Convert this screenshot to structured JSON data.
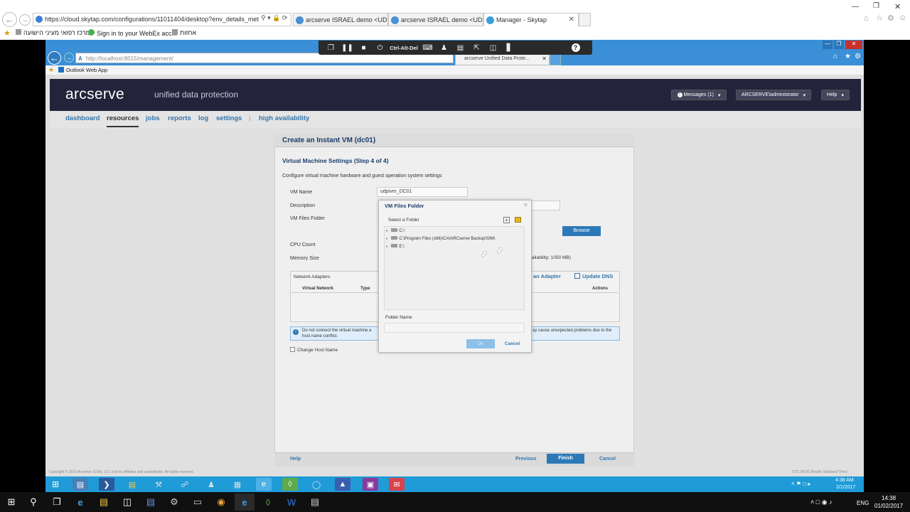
{
  "outer_browser": {
    "address": "https://cloud.skytap.com/configurations/11011404/desktop?env_details_meta_info=",
    "tabs": [
      {
        "label": "arcserve ISRAEL demo <UDP v..."
      },
      {
        "label": "arcserve ISRAEL demo <UDP v..."
      },
      {
        "label": "Manager - Skytap"
      }
    ],
    "favorites": [
      "מרכז רפואי מעיני הישועה",
      "Sign in to your WebEx acc...",
      "אחזות"
    ]
  },
  "remote_toolbar": {
    "ctrl_alt_del": "Ctrl-Alt-Del",
    "help_glyph": "?"
  },
  "inner_browser": {
    "address": "http://localhost:8015/management/",
    "tab_label": "arcserve Unified Data Prote...",
    "favorite": "Outlook Web App"
  },
  "arcserve": {
    "logo": "arcserve",
    "tagline": "unified data protection",
    "header_buttons": {
      "messages": "Messages (1)",
      "user": "ARCSERVE\\administrator",
      "help": "Help"
    },
    "nav": [
      "dashboard",
      "resources",
      "jobs",
      "reports",
      "log",
      "settings",
      "high availability"
    ]
  },
  "wizard": {
    "title": "Create an Instant VM (dc01)",
    "step_title": "Virtual Machine Settings (Step 4 of 4)",
    "description": "Configure virtual machine hardware and guest operation system settings",
    "labels": {
      "vm_name": "VM Name",
      "description": "Description",
      "vm_files_folder": "VM Files Folder",
      "cpu_count": "CPU Count",
      "memory_size": "Memory Size"
    },
    "vm_name_value": "udpivm_DC01",
    "browse_label": "Browse",
    "availability_text": "ailability: 1050 MB)",
    "network_adapters": {
      "title": "Network Adapters",
      "add_adapter": "an Adapter",
      "update_dns": "Update DNS",
      "columns": {
        "virtual_network": "Virtual Network",
        "type": "Type",
        "actions": "Actions"
      }
    },
    "info_text_1": "Do not connect the virtual machine a",
    "info_text_1b": "ay cause unexpected problems due to the",
    "info_text_2": "host name conflict.",
    "change_host_name": "Change Host Name",
    "footer": {
      "help": "Help",
      "previous": "Previous",
      "finish": "Finish",
      "cancel": "Cancel"
    }
  },
  "dialog": {
    "title": "VM Files Folder",
    "select_label": "Select a Folder",
    "folders": [
      "C:\\",
      "C:\\Program Files (x86)\\CA\\ARCserve Backup\\SIM\\",
      "E:\\"
    ],
    "folder_name_label": "Folder Name",
    "ok": "OK",
    "cancel": "Cancel"
  },
  "page_footer": {
    "copyright": "Copyright © 2016 Arcserve (USA), LLC and its affiliates and subsidiaries. All rights reserved.",
    "timezone": "UTC-08:00 (Pacific Standard Time)"
  },
  "inner_clock": {
    "time": "4:38 AM",
    "date": "2/1/2017"
  },
  "outer_clock": {
    "time": "14:38",
    "date": "01/02/2017",
    "lang": "ENG"
  },
  "colors": {
    "arc_header": "#23233b",
    "link_blue": "#3576ad",
    "accent_blue": "#1f9bd8"
  }
}
